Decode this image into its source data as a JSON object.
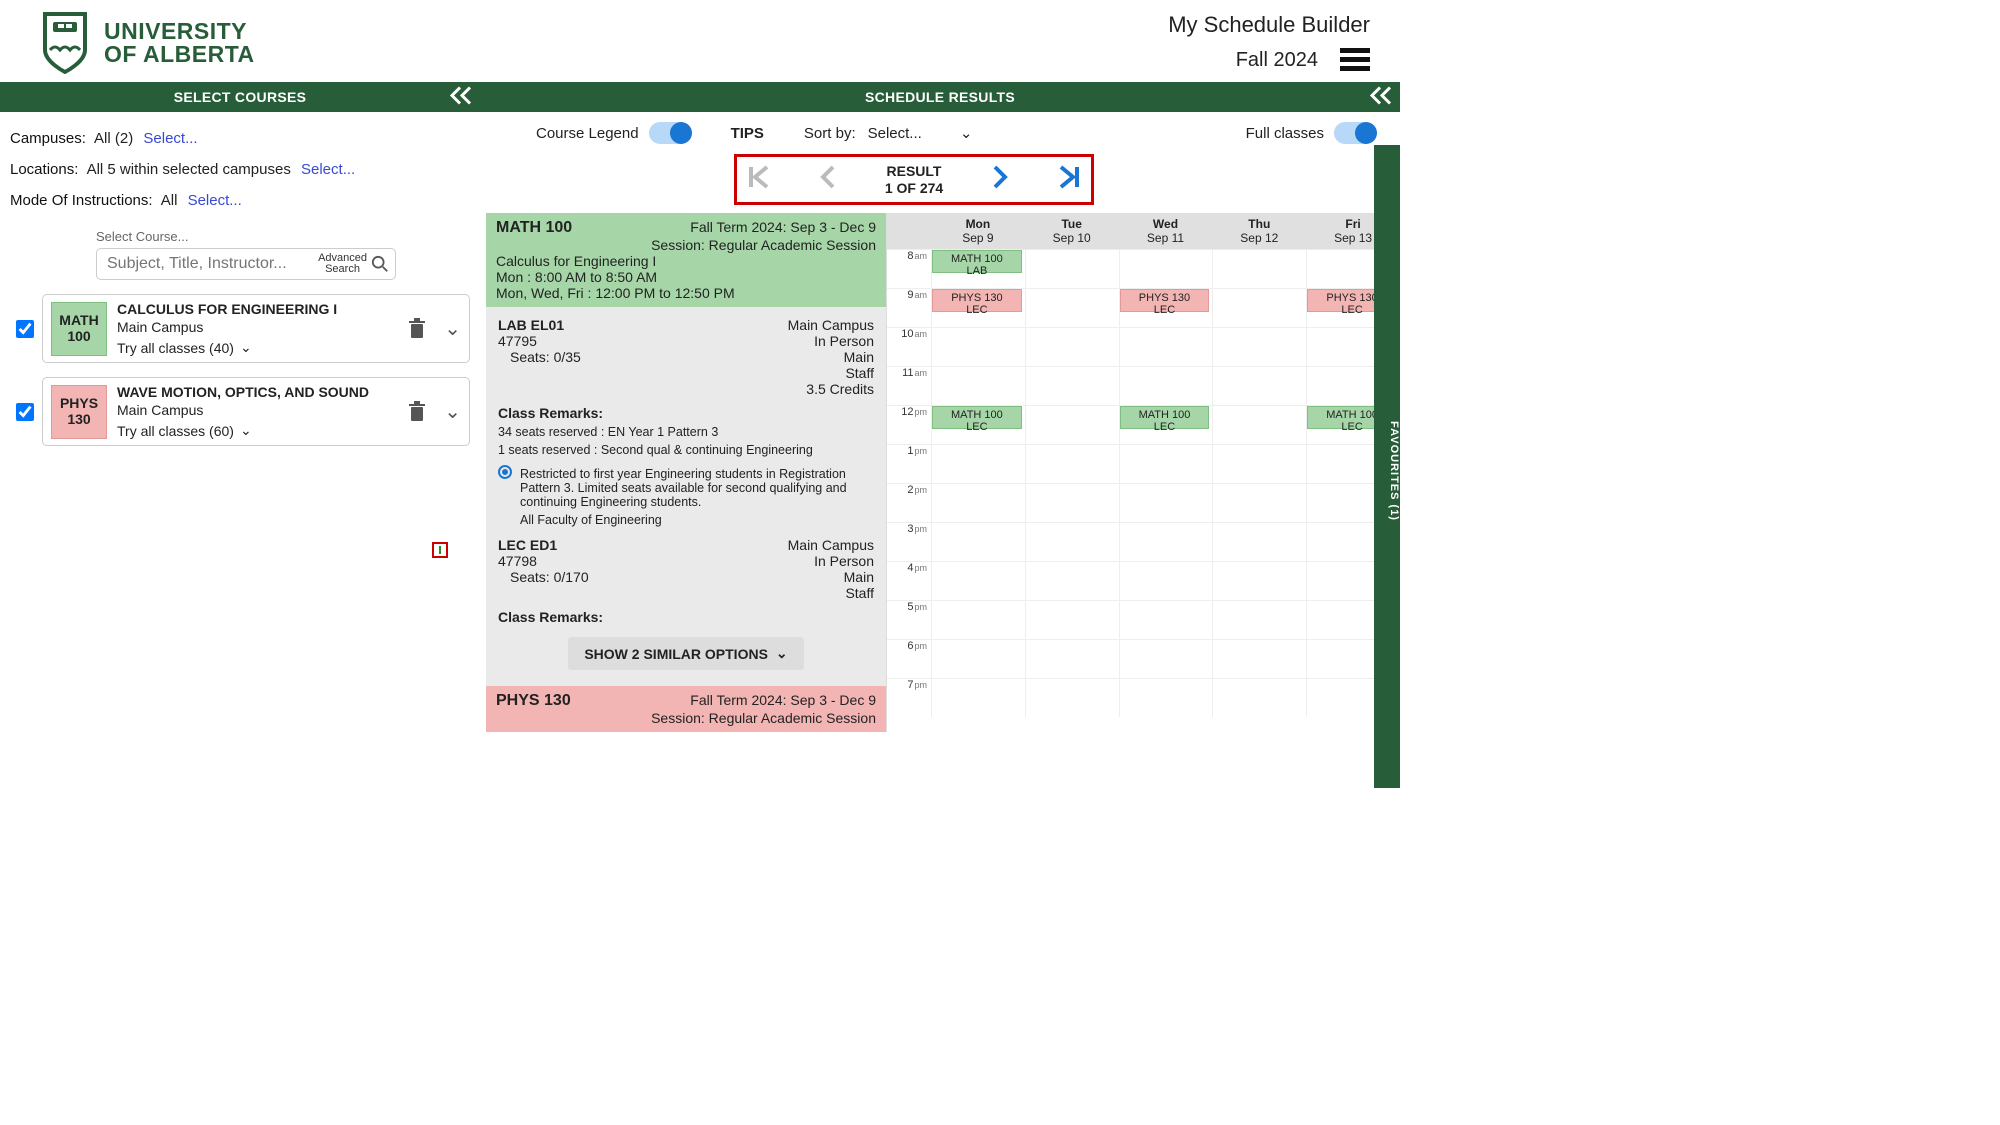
{
  "header": {
    "uni_line1": "UNIVERSITY",
    "uni_line2": "OF ALBERTA",
    "title": "My Schedule Builder",
    "term": "Fall 2024"
  },
  "bars": {
    "left": "SELECT COURSES",
    "right": "SCHEDULE RESULTS"
  },
  "filters": {
    "campuses_label": "Campuses:",
    "campuses_val": "All (2)",
    "locations_label": "Locations:",
    "locations_val": "All 5 within selected campuses",
    "mode_label": "Mode Of Instructions:",
    "mode_val": "All",
    "select": "Select..."
  },
  "search": {
    "label": "Select Course...",
    "placeholder": "Subject, Title, Instructor...",
    "adv": "Advanced\nSearch"
  },
  "courses": [
    {
      "code_top": "MATH",
      "code_bot": "100",
      "color": "green",
      "title": "CALCULUS FOR ENGINEERING I",
      "campus": "Main Campus",
      "try": "Try all classes (40)"
    },
    {
      "code_top": "PHYS",
      "code_bot": "130",
      "color": "red",
      "title": "WAVE MOTION, OPTICS, AND SOUND",
      "campus": "Main Campus",
      "try": "Try all classes (60)"
    }
  ],
  "rt": {
    "legend": "Course Legend",
    "tips": "TIPS",
    "sortby_label": "Sort by:",
    "sortby_val": "Select...",
    "full": "Full classes"
  },
  "pager": {
    "l1": "RESULT",
    "l2": "1 OF 274"
  },
  "detail": {
    "math": {
      "code": "MATH 100",
      "term": "Fall Term 2024: Sep 3 - Dec 9",
      "session": "Session: Regular Academic Session",
      "name": "Calculus for Engineering I",
      "time1": "Mon : 8:00 AM to 8:50 AM",
      "time2": "Mon, Wed, Fri : 12:00 PM to 12:50 PM",
      "lab_title": "LAB EL01",
      "lab_id": "47795",
      "lab_seats": "Seats: 0/35",
      "campus": "Main Campus",
      "mode": "In Person",
      "room": "Main",
      "staff": "Staff",
      "credits": "3.5 Credits",
      "remarks_label": "Class Remarks:",
      "rem1": "34 seats reserved : EN Year 1 Pattern 3",
      "rem2": "1 seats reserved : Second qual & continuing Engineering",
      "restrict": "Restricted to first year Engineering students in Registration Pattern 3. Limited seats available for second qualifying and continuing Engineering students.",
      "faculty": "All Faculty of Engineering",
      "lec_title": "LEC ED1",
      "lec_id": "47798",
      "lec_seats": "Seats: 0/170",
      "similar": "SHOW 2 SIMILAR OPTIONS"
    },
    "phys": {
      "code": "PHYS 130",
      "term": "Fall Term 2024: Sep 3 - Dec 9",
      "session": "Session: Regular Academic Session"
    }
  },
  "calendar": {
    "days": [
      {
        "dw": "Mon",
        "dt": "Sep 9"
      },
      {
        "dw": "Tue",
        "dt": "Sep 10"
      },
      {
        "dw": "Wed",
        "dt": "Sep 11"
      },
      {
        "dw": "Thu",
        "dt": "Sep 12"
      },
      {
        "dw": "Fri",
        "dt": "Sep 13"
      }
    ],
    "hours": [
      "8",
      "9",
      "10",
      "11",
      "12",
      "1",
      "2",
      "3",
      "4",
      "5",
      "6",
      "7"
    ],
    "ampm": [
      "am",
      "am",
      "am",
      "am",
      "pm",
      "pm",
      "pm",
      "pm",
      "pm",
      "pm",
      "pm",
      "pm"
    ],
    "events": {
      "math_lab": {
        "l1": "MATH 100",
        "l2": "LAB"
      },
      "phys_lec": {
        "l1": "PHYS 130",
        "l2": "LEC"
      },
      "math_lec": {
        "l1": "MATH 100",
        "l2": "LEC"
      }
    }
  },
  "favourites": "FAVOURITES (1)"
}
